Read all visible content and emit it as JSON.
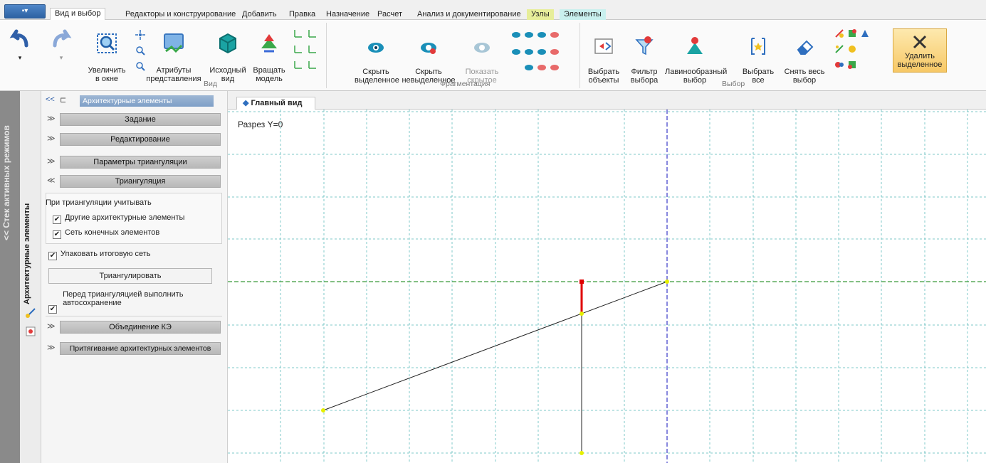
{
  "app_button": "▪▾",
  "tabs": [
    {
      "label": "Вид и выбор"
    },
    {
      "label": "Редакторы и конструирование"
    },
    {
      "label": "Добавить"
    },
    {
      "label": "Правка"
    },
    {
      "label": "Назначение"
    },
    {
      "label": "Расчет"
    },
    {
      "label": "Анализ и документирование"
    },
    {
      "label": "Узлы"
    },
    {
      "label": "Элементы"
    }
  ],
  "ribbon": {
    "zoom_label": "Увеличить\nв окне",
    "attributes_label": "Атрибуты\nпредставления",
    "initial_view_label": "Исходный\nвид",
    "rotate_label": "Вращать\nмодель",
    "group_view": "Вид",
    "hide_selected_label": "Скрыть\nвыделенное",
    "hide_unselected_label": "Скрыть\nневыделенное",
    "show_hidden_label": "Показать\nскрытое",
    "group_fragment": "Фрагментация",
    "select_objects_label": "Выбрать\nобъекты",
    "filter_label": "Фильтр\nвыбора",
    "avalanche_label": "Лавинообразный\nвыбор",
    "select_all_label": "Выбрать\nвсе",
    "deselect_label": "Снять весь\nвыбор",
    "group_select": "Выбор",
    "delete_label": "Удалить\nвыделенное"
  },
  "left_stack": {
    "modes_title": "<< Стек активных режимов",
    "arch_title": "Архитектурные элементы"
  },
  "panel": {
    "back": "<<",
    "pin": "⊏",
    "title": "Архитектурные элементы",
    "sections": [
      {
        "label": "Задание",
        "chev": "≫"
      },
      {
        "label": "Редактирование",
        "chev": "≫"
      },
      {
        "label": "Параметры триангуляции",
        "chev": "≫"
      },
      {
        "label": "Триангуляция",
        "chev": "≪"
      }
    ],
    "group_title": "При триангуляции учитывать",
    "opt_other": "Другие архитектурные элементы",
    "opt_fem": "Сеть конечных элементов",
    "opt_pack": "Упаковать итоговую сеть",
    "triangulate_btn": "Триангулировать",
    "opt_autosave_1": "Перед триангуляцией выполнить",
    "opt_autosave_2": "автосохранение",
    "merge_label": "Объединение КЭ",
    "snap_label": "Притягивание архитектурных элементов"
  },
  "viewport": {
    "tab": "Главный вид",
    "section_label": "Разрез Y=0"
  },
  "colors": {
    "ribbon_accent": "#2d62a3",
    "highlight": "#f7c866",
    "grid_line": "#7fc9c9",
    "axis_line": "#3a3ac8",
    "selected_element": "#e00000",
    "node": "#e6f000"
  }
}
